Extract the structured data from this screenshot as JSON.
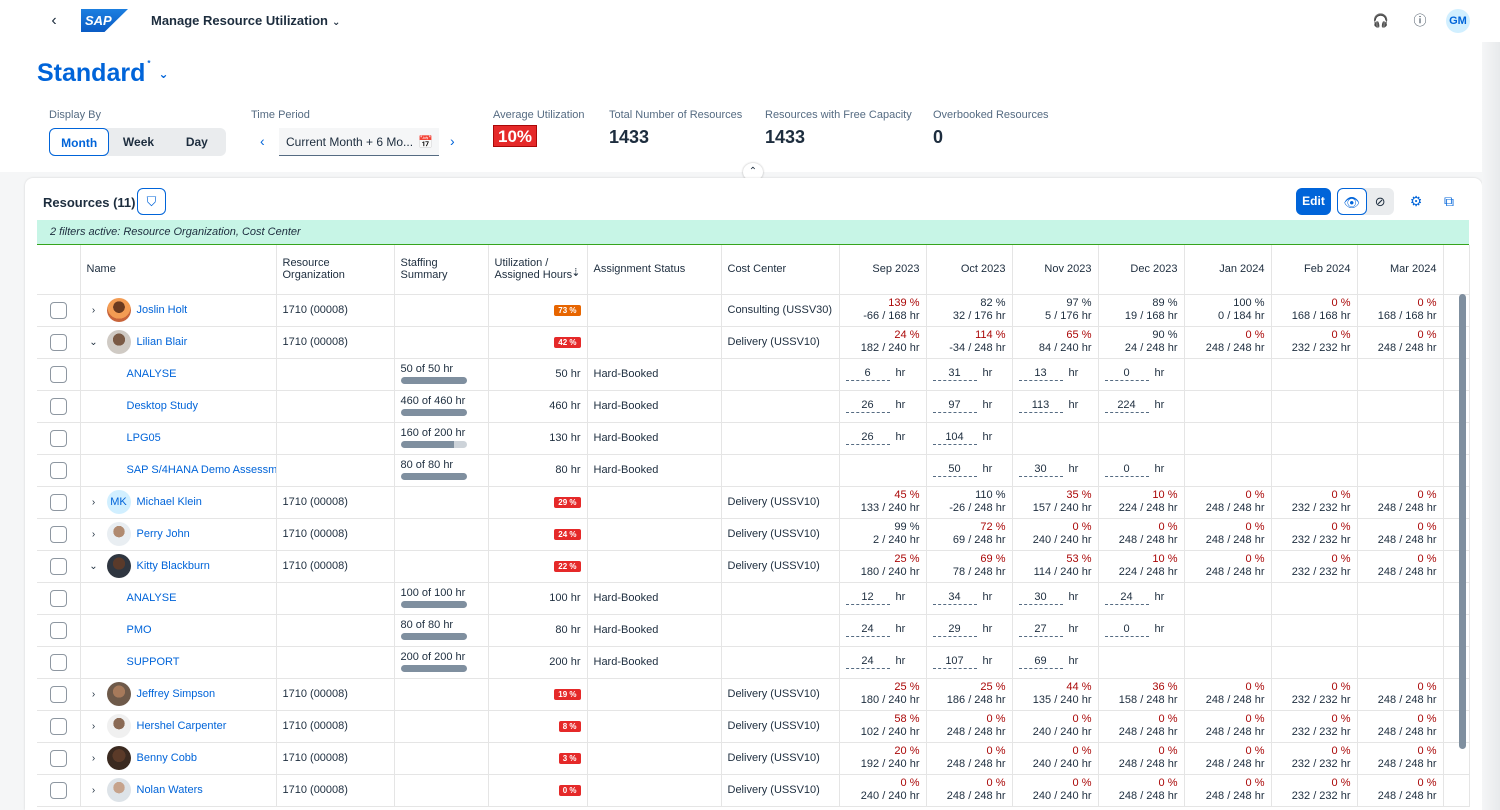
{
  "shell": {
    "logo": "SAP",
    "title": "Manage Resource Utilization",
    "user_initials": "GM"
  },
  "header": {
    "variant": "Standard",
    "variant_modified": "*",
    "display_by_label": "Display By",
    "display_by_options": [
      "Month",
      "Week",
      "Day"
    ],
    "time_period_label": "Time Period",
    "time_period_value": "Current Month + 6 Mo...",
    "kpis": [
      {
        "label": "Average Utilization",
        "value": "10%"
      },
      {
        "label": "Total Number of Resources",
        "value": "1433"
      },
      {
        "label": "Resources with Free Capacity",
        "value": "1433"
      },
      {
        "label": "Overbooked Resources",
        "value": "0"
      }
    ]
  },
  "table": {
    "title": "Resources (11)",
    "edit_label": "Edit",
    "filter_info": "2 filters active: Resource Organization, Cost Center",
    "columns": {
      "name": "Name",
      "org": "Resource Organization",
      "staffing": "Staffing Summary",
      "util": "Utilization / Assigned Hours",
      "status": "Assignment Status",
      "cost": "Cost Center"
    },
    "months": [
      "Sep 2023",
      "Oct 2023",
      "Nov 2023",
      "Dec 2023",
      "Jan 2024",
      "Feb 2024",
      "Mar 2024"
    ],
    "rows": [
      {
        "type": "res",
        "expanded": false,
        "avatar": "photo-f1",
        "name": "Joslin Holt",
        "org": "1710 (00008)",
        "util": "73 %",
        "util_color": "orange",
        "cost": "Consulting (USSV30)",
        "months": [
          [
            "139 %",
            "-66 / 168 hr",
            true
          ],
          [
            "82 %",
            "32 / 176 hr",
            false
          ],
          [
            "97 %",
            "5 / 176 hr",
            false
          ],
          [
            "89 %",
            "19 / 168 hr",
            false
          ],
          [
            "100 %",
            "0 / 184 hr",
            false
          ],
          [
            "0 %",
            "168 / 168 hr",
            true
          ],
          [
            "0 %",
            "168 / 168 hr",
            true
          ]
        ]
      },
      {
        "type": "res",
        "expanded": true,
        "avatar": "photo-m1",
        "name": "Lilian Blair",
        "org": "1710 (00008)",
        "util": "42 %",
        "util_color": "red",
        "cost": "Delivery (USSV10)",
        "months": [
          [
            "24 %",
            "182 / 240 hr",
            true
          ],
          [
            "114 %",
            "-34 / 248 hr",
            true
          ],
          [
            "65 %",
            "84 / 240 hr",
            true
          ],
          [
            "90 %",
            "24 / 248 hr",
            false
          ],
          [
            "0 %",
            "248 / 248 hr",
            true
          ],
          [
            "0 %",
            "232 / 232 hr",
            true
          ],
          [
            "0 %",
            "248 / 248 hr",
            true
          ]
        ]
      },
      {
        "type": "sub",
        "name": "ANALYSE",
        "staffing": "50 of 50 hr",
        "full": true,
        "assigned": "50 hr",
        "status": "Hard-Booked",
        "hours": [
          "6",
          "31",
          "13",
          "0",
          "",
          "",
          ""
        ]
      },
      {
        "type": "sub",
        "name": "Desktop Study",
        "staffing": "460 of 460 hr",
        "full": true,
        "assigned": "460 hr",
        "status": "Hard-Booked",
        "hours": [
          "26",
          "97",
          "113",
          "224",
          "",
          "",
          ""
        ]
      },
      {
        "type": "sub",
        "name": "LPG05",
        "staffing": "160 of 200 hr",
        "full": false,
        "assigned": "130 hr",
        "status": "Hard-Booked",
        "hours": [
          "26",
          "104",
          "",
          "",
          "",
          "",
          ""
        ]
      },
      {
        "type": "sub",
        "name": "SAP S/4HANA Demo Assessm",
        "staffing": "80 of 80 hr",
        "full": true,
        "assigned": "80 hr",
        "status": "Hard-Booked",
        "hours": [
          "",
          "50",
          "30",
          "0",
          "",
          "",
          ""
        ]
      },
      {
        "type": "res",
        "expanded": false,
        "avatar": "initials",
        "initials": "MK",
        "name": "Michael Klein",
        "org": "1710 (00008)",
        "util": "29 %",
        "util_color": "red",
        "cost": "Delivery (USSV10)",
        "months": [
          [
            "45 %",
            "133 / 240 hr",
            true
          ],
          [
            "110 %",
            "-26 / 248 hr",
            false
          ],
          [
            "35 %",
            "157 / 240 hr",
            true
          ],
          [
            "10 %",
            "224 / 248 hr",
            true
          ],
          [
            "0 %",
            "248 / 248 hr",
            true
          ],
          [
            "0 %",
            "232 / 232 hr",
            true
          ],
          [
            "0 %",
            "248 / 248 hr",
            true
          ]
        ]
      },
      {
        "type": "res",
        "expanded": false,
        "avatar": "photo-m2",
        "name": "Perry John",
        "org": "1710 (00008)",
        "util": "24 %",
        "util_color": "red",
        "cost": "Delivery (USSV10)",
        "months": [
          [
            "99 %",
            "2 / 240 hr",
            false
          ],
          [
            "72 %",
            "69 / 248 hr",
            true
          ],
          [
            "0 %",
            "240 / 240 hr",
            true
          ],
          [
            "0 %",
            "248 / 248 hr",
            true
          ],
          [
            "0 %",
            "248 / 248 hr",
            true
          ],
          [
            "0 %",
            "232 / 232 hr",
            true
          ],
          [
            "0 %",
            "248 / 248 hr",
            true
          ]
        ]
      },
      {
        "type": "res",
        "expanded": true,
        "avatar": "photo-m3",
        "name": "Kitty Blackburn",
        "org": "1710 (00008)",
        "util": "22 %",
        "util_color": "red",
        "cost": "Delivery (USSV10)",
        "months": [
          [
            "25 %",
            "180 / 240 hr",
            true
          ],
          [
            "69 %",
            "78 / 248 hr",
            true
          ],
          [
            "53 %",
            "114 / 240 hr",
            true
          ],
          [
            "10 %",
            "224 / 248 hr",
            true
          ],
          [
            "0 %",
            "248 / 248 hr",
            true
          ],
          [
            "0 %",
            "232 / 232 hr",
            true
          ],
          [
            "0 %",
            "248 / 248 hr",
            true
          ]
        ]
      },
      {
        "type": "sub",
        "name": "ANALYSE",
        "staffing": "100 of 100 hr",
        "full": true,
        "assigned": "100 hr",
        "status": "Hard-Booked",
        "hours": [
          "12",
          "34",
          "30",
          "24",
          "",
          "",
          ""
        ]
      },
      {
        "type": "sub",
        "name": "PMO",
        "staffing": "80 of 80 hr",
        "full": true,
        "assigned": "80 hr",
        "status": "Hard-Booked",
        "hours": [
          "24",
          "29",
          "27",
          "0",
          "",
          "",
          ""
        ]
      },
      {
        "type": "sub",
        "name": "SUPPORT",
        "staffing": "200 of 200 hr",
        "full": true,
        "assigned": "200 hr",
        "status": "Hard-Booked",
        "hours": [
          "24",
          "107",
          "69",
          "",
          "",
          "",
          ""
        ]
      },
      {
        "type": "res",
        "expanded": false,
        "avatar": "photo-m4",
        "name": "Jeffrey Simpson",
        "org": "1710 (00008)",
        "util": "19 %",
        "util_color": "red",
        "cost": "Delivery (USSV10)",
        "months": [
          [
            "25 %",
            "180 / 240 hr",
            true
          ],
          [
            "25 %",
            "186 / 248 hr",
            true
          ],
          [
            "44 %",
            "135 / 240 hr",
            true
          ],
          [
            "36 %",
            "158 / 248 hr",
            true
          ],
          [
            "0 %",
            "248 / 248 hr",
            true
          ],
          [
            "0 %",
            "232 / 232 hr",
            true
          ],
          [
            "0 %",
            "248 / 248 hr",
            true
          ]
        ]
      },
      {
        "type": "res",
        "expanded": false,
        "avatar": "photo-m5",
        "name": "Hershel Carpenter",
        "org": "1710 (00008)",
        "util": "8 %",
        "util_color": "red",
        "cost": "Delivery (USSV10)",
        "months": [
          [
            "58 %",
            "102 / 240 hr",
            true
          ],
          [
            "0 %",
            "248 / 248 hr",
            true
          ],
          [
            "0 %",
            "240 / 240 hr",
            true
          ],
          [
            "0 %",
            "248 / 248 hr",
            true
          ],
          [
            "0 %",
            "248 / 248 hr",
            true
          ],
          [
            "0 %",
            "232 / 232 hr",
            true
          ],
          [
            "0 %",
            "248 / 248 hr",
            true
          ]
        ]
      },
      {
        "type": "res",
        "expanded": false,
        "avatar": "photo-m6",
        "name": "Benny Cobb",
        "org": "1710 (00008)",
        "util": "3 %",
        "util_color": "red",
        "cost": "Delivery (USSV10)",
        "months": [
          [
            "20 %",
            "192 / 240 hr",
            true
          ],
          [
            "0 %",
            "248 / 248 hr",
            true
          ],
          [
            "0 %",
            "240 / 240 hr",
            true
          ],
          [
            "0 %",
            "248 / 248 hr",
            true
          ],
          [
            "0 %",
            "248 / 248 hr",
            true
          ],
          [
            "0 %",
            "232 / 232 hr",
            true
          ],
          [
            "0 %",
            "248 / 248 hr",
            true
          ]
        ]
      },
      {
        "type": "res",
        "expanded": false,
        "avatar": "photo-m7",
        "name": "Nolan Waters",
        "org": "1710 (00008)",
        "util": "0 %",
        "util_color": "red",
        "cost": "Delivery (USSV10)",
        "months": [
          [
            "0 %",
            "240 / 240 hr",
            true
          ],
          [
            "0 %",
            "248 / 248 hr",
            true
          ],
          [
            "0 %",
            "240 / 240 hr",
            true
          ],
          [
            "0 %",
            "248 / 248 hr",
            true
          ],
          [
            "0 %",
            "248 / 248 hr",
            true
          ],
          [
            "0 %",
            "232 / 232 hr",
            true
          ],
          [
            "0 %",
            "248 / 248 hr",
            true
          ]
        ]
      }
    ],
    "hour_unit": "hr"
  },
  "colors": {
    "brand": "#0064d9",
    "negative": "#aa0808",
    "info_bg": "#c7f5e6"
  }
}
